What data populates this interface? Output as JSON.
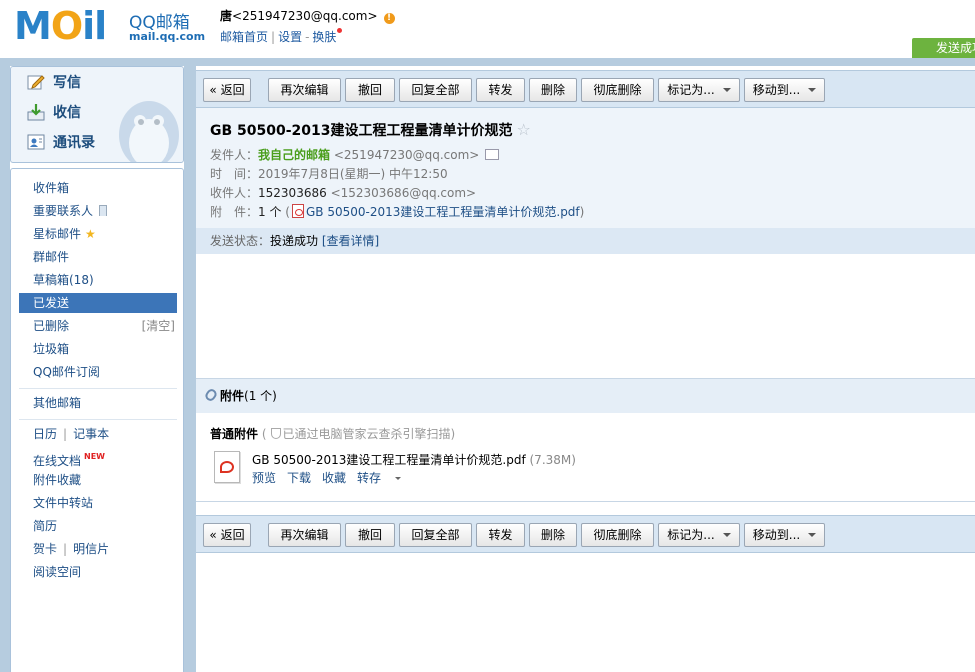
{
  "header": {
    "logo_text": "MOil",
    "logo_name": "QQ邮箱",
    "logo_domain": "mail.qq.com",
    "user_name": "唐",
    "user_email": "<251947230@qq.com>",
    "alert_symbol": "!",
    "links": [
      "邮箱首页",
      "设置",
      "换肤"
    ],
    "link_sep1": "|",
    "link_sep2": "-",
    "send_status_tab": "发送成功"
  },
  "sidebar": {
    "actions": [
      {
        "label": "写信",
        "icon": "compose-icon"
      },
      {
        "label": "收信",
        "icon": "inbox-download-icon"
      },
      {
        "label": "通讯录",
        "icon": "contacts-icon"
      }
    ],
    "folders": [
      {
        "label": "收件箱"
      },
      {
        "label": "重要联系人"
      },
      {
        "label": "星标邮件"
      },
      {
        "label": "群邮件"
      },
      {
        "label": "草稿箱(18)"
      },
      {
        "label": "已发送"
      },
      {
        "label": "已删除",
        "extra": "[清空]"
      },
      {
        "label": "垃圾箱"
      },
      {
        "label": "QQ邮件订阅"
      }
    ],
    "other_mail": "其他邮箱",
    "apps": {
      "calendar": "日历",
      "notes": "记事本",
      "pipe": "|",
      "online_docs": "在线文档",
      "new_badge": "NEW",
      "attach_fav": "附件收藏",
      "file_transfer": "文件中转站",
      "resume": "简历",
      "card": "贺卡",
      "postcard": "明信片",
      "reading": "阅读空间"
    }
  },
  "toolbar": {
    "back": "« 返回",
    "re_edit": "再次编辑",
    "recall": "撤回",
    "reply_all": "回复全部",
    "forward": "转发",
    "delete": "删除",
    "delete_perm": "彻底删除",
    "mark_as": "标记为...",
    "move_to": "移动到..."
  },
  "mail": {
    "subject": "GB 50500-2013建设工程工程量清单计价规范",
    "star": "☆",
    "from_label": "发件人：",
    "from_name": "我自己的邮箱",
    "from_addr": "<251947230@qq.com>",
    "time_label": "时　间：",
    "time_value": "2019年7月8日(星期一) 中午12:50",
    "to_label": "收件人：",
    "to_name": "152303686",
    "to_addr": "<152303686@qq.com>",
    "attach_label": "附　件：",
    "attach_count": "1 个",
    "attach_open": "(",
    "attach_name": "GB 50500-2013建设工程工程量清单计价规范.pdf",
    "attach_close": ")",
    "status_label": "发送状态：",
    "status_value": "投递成功",
    "status_link": "[查看详情]"
  },
  "attachments": {
    "title": "附件",
    "count": "(1 个)",
    "normal_label": "普通附件",
    "scan_open": "(",
    "scan_note": "已通过电脑管家云查杀引擎扫描",
    "scan_close": ")",
    "file_name": "GB 50500-2013建设工程工程量清单计价规范.pdf",
    "file_size": "(7.38M)",
    "actions": [
      "预览",
      "下载",
      "收藏",
      "转存"
    ]
  }
}
